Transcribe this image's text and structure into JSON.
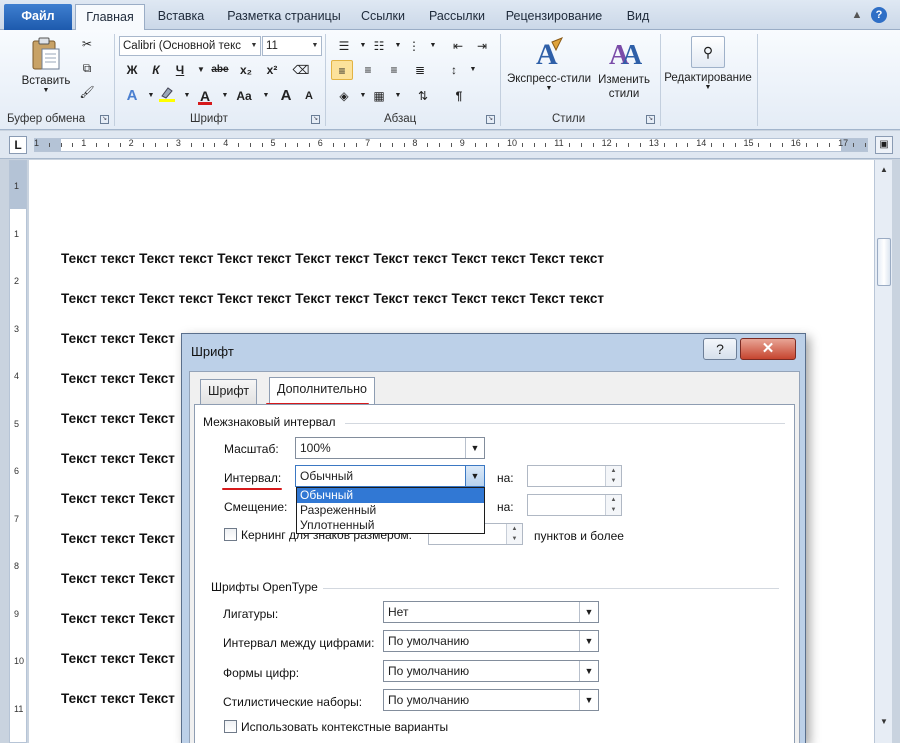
{
  "ribbon_tabs": {
    "file": "Файл",
    "home": "Главная",
    "insert": "Вставка",
    "layout": "Разметка страницы",
    "references": "Ссылки",
    "mailings": "Рассылки",
    "review": "Рецензирование",
    "view": "Вид"
  },
  "ribbon": {
    "clipboard": {
      "paste_label": "Вставить",
      "group_label": "Буфер обмена"
    },
    "font": {
      "font_name": "Calibri (Основной текс",
      "font_size": "11",
      "bold": "Ж",
      "italic": "К",
      "underline": "Ч",
      "strike": "abe",
      "subscript": "x₂",
      "superscript": "x²",
      "change_case": "Aa",
      "grow": "A",
      "shrink": "A",
      "group_label": "Шрифт"
    },
    "paragraph": {
      "group_label": "Абзац"
    },
    "styles": {
      "express_label": "Экспресс-стили",
      "change_label": "Изменить стили",
      "group_label": "Стили"
    },
    "editing": {
      "label": "Редактирование"
    }
  },
  "ruler": {
    "corner": "L",
    "numbers": [
      "1",
      "1",
      "2",
      "3",
      "4",
      "5",
      "6",
      "7",
      "8",
      "9",
      "10",
      "11",
      "12",
      "13",
      "14",
      "15",
      "16",
      "17"
    ],
    "vertical_numbers": [
      "1",
      "1",
      "2",
      "3",
      "4",
      "5",
      "6",
      "7",
      "8",
      "9",
      "10",
      "11"
    ]
  },
  "document": {
    "full_line": "Текст текст Текст текст Текст текст Текст текст Текст текст Текст текст Текст текст",
    "short_line": "Текст текст Текст"
  },
  "dialog": {
    "title": "Шрифт",
    "help": "?",
    "close": "✕",
    "tabs": {
      "font": "Шрифт",
      "advanced": "Дополнительно"
    },
    "spacing_section": "Межзнаковый интервал",
    "scale_label": "Масштаб:",
    "scale_value": "100%",
    "spacing_label": "Интервал:",
    "spacing_value": "Обычный",
    "spacing_by_label": "на:",
    "position_label": "Смещение:",
    "position_by_label": "на:",
    "spacing_options": [
      "Обычный",
      "Разреженный",
      "Уплотненный"
    ],
    "kerning_label": "Кернинг для знаков размером:",
    "kerning_suffix": "пунктов и более",
    "opentype_section": "Шрифты OpenType",
    "ligatures_label": "Лигатуры:",
    "ligatures_value": "Нет",
    "number_spacing_label": "Интервал между цифрами:",
    "number_spacing_value": "По умолчанию",
    "number_forms_label": "Формы цифр:",
    "number_forms_value": "По умолчанию",
    "stylistic_sets_label": "Стилистические наборы:",
    "stylistic_sets_value": "По умолчанию",
    "contextual_label": "Использовать контекстные варианты"
  },
  "colors": {
    "accent": "#2f6fc6",
    "highlight_marker": "#d6191b",
    "selection": "#3178d4"
  }
}
